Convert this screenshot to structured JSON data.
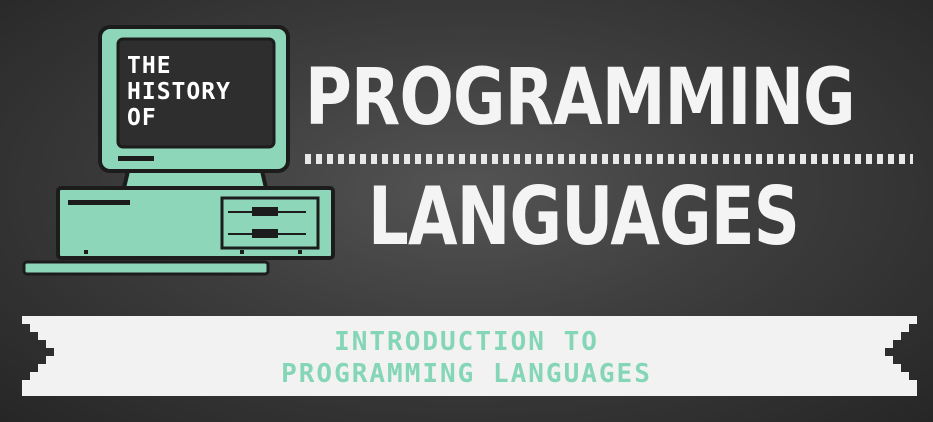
{
  "header": {
    "screen_line1": "THE",
    "screen_line2": "HISTORY",
    "screen_line3": "OF",
    "title_line1": "PROGRAMMING",
    "title_line2": "LANGUAGES"
  },
  "banner": {
    "line1": "INTRODUCTION TO",
    "line2": "PROGRAMMING LANGUAGES"
  },
  "colors": {
    "background": "#3d3d3d",
    "computer": "#8ed6b9",
    "screen": "#2e2e2e",
    "title": "#f4f4f4",
    "banner": "#f2f2f2",
    "banner_text": "#84d6b6"
  },
  "icons": {
    "illustration": "retro-computer-icon"
  }
}
